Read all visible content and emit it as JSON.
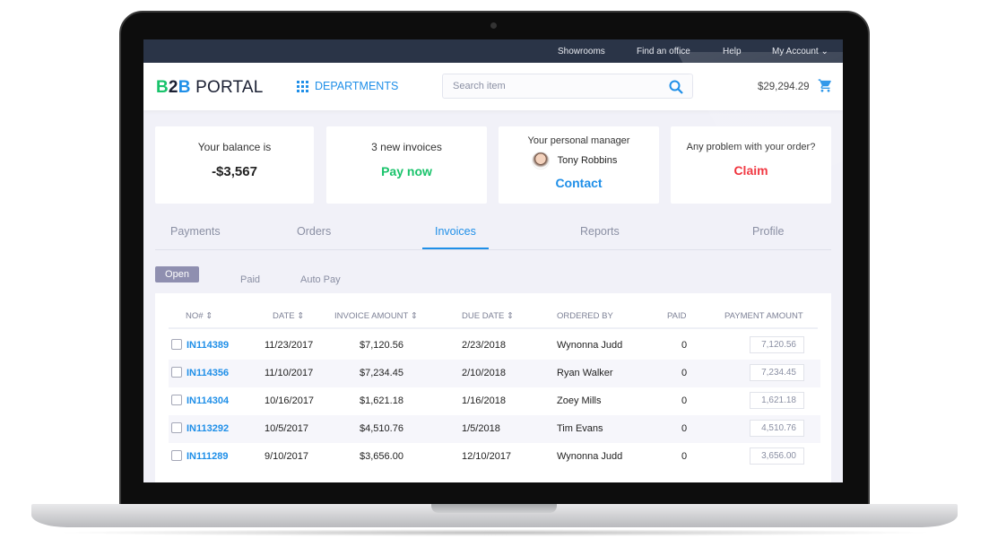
{
  "topbar": {
    "links": [
      "Showrooms",
      "Find an office",
      "Help"
    ],
    "account": "My Account"
  },
  "header": {
    "logo_b": "B",
    "logo_2": "2",
    "logo_b2": "B",
    "logo_rest": " PORTAL",
    "departments": "DEPARTMENTS",
    "search_placeholder": "Search item",
    "balance": "$29,294.29"
  },
  "cards": {
    "balance": {
      "label": "Your balance is",
      "value": "-$3,567"
    },
    "invoices": {
      "label": "3 new invoices",
      "action": "Pay now"
    },
    "manager": {
      "label": "Your personal manager",
      "name": "Tony Robbins",
      "action": "Contact"
    },
    "problem": {
      "label": "Any problem with your order?",
      "action": "Claim"
    }
  },
  "tabs": [
    "Payments",
    "Orders",
    "Invoices",
    "Reports",
    "Profile"
  ],
  "active_tab": "Invoices",
  "subtabs": [
    "Open",
    "Paid",
    "Auto Pay"
  ],
  "table": {
    "columns": [
      "NO#",
      "DATE",
      "INVOICE AMOUNT",
      "DUE DATE",
      "ORDERED BY",
      "PAID",
      "PAYMENT AMOUNT"
    ],
    "rows": [
      {
        "no": "IN114389",
        "date": "11/23/2017",
        "amount": "$7,120.56",
        "due": "2/23/2018",
        "by": "Wynonna Judd",
        "paid": "0",
        "payment": "7,120.56"
      },
      {
        "no": "IN114356",
        "date": "11/10/2017",
        "amount": "$7,234.45",
        "due": "2/10/2018",
        "by": "Ryan Walker",
        "paid": "0",
        "payment": "7,234.45"
      },
      {
        "no": "IN114304",
        "date": "10/16/2017",
        "amount": "$1,621.18",
        "due": "1/16/2018",
        "by": "Zoey Mills",
        "paid": "0",
        "payment": "1,621.18"
      },
      {
        "no": "IN113292",
        "date": "10/5/2017",
        "amount": "$4,510.76",
        "due": "1/5/2018",
        "by": "Tim Evans",
        "paid": "0",
        "payment": "4,510.76"
      },
      {
        "no": "IN111289",
        "date": "9/10/2017",
        "amount": "$3,656.00",
        "due": "12/10/2017",
        "by": "Wynonna Judd",
        "paid": "0",
        "payment": "3,656.00"
      }
    ]
  },
  "colors": {
    "accent": "#1f8fe8",
    "green": "#19c36b",
    "red": "#f0303a",
    "topbar": "#2a3447"
  }
}
